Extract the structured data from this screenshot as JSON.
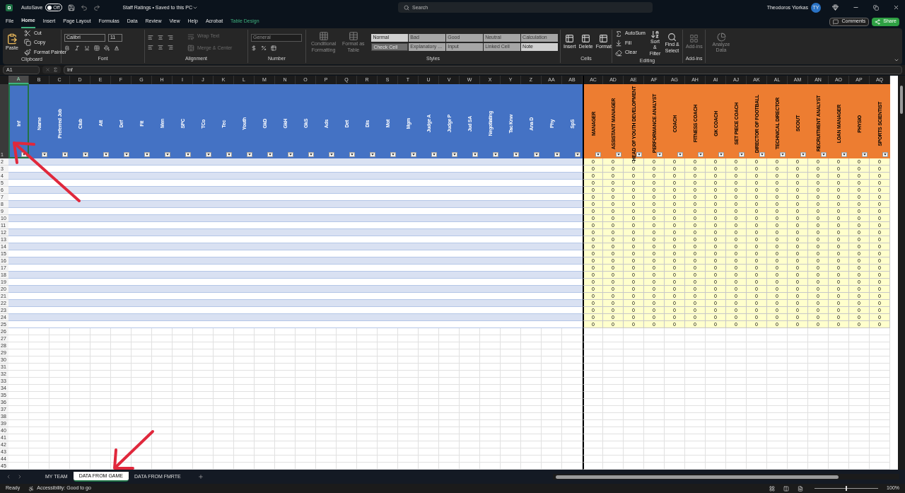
{
  "window": {
    "autosave_label": "AutoSave",
    "autosave_on": false,
    "autosave_state": "Off",
    "title": "Staff Ratings • Saved to this PC",
    "search_placeholder": "Search",
    "user_name": "Theodoros Yiorkas",
    "user_initials": "TY"
  },
  "menu_tabs": [
    {
      "label": "File",
      "selected": false,
      "kind": "standard"
    },
    {
      "label": "Home",
      "selected": true,
      "kind": "standard"
    },
    {
      "label": "Insert",
      "selected": false,
      "kind": "standard"
    },
    {
      "label": "Page Layout",
      "selected": false,
      "kind": "standard"
    },
    {
      "label": "Formulas",
      "selected": false,
      "kind": "standard"
    },
    {
      "label": "Data",
      "selected": false,
      "kind": "standard"
    },
    {
      "label": "Review",
      "selected": false,
      "kind": "standard"
    },
    {
      "label": "View",
      "selected": false,
      "kind": "standard"
    },
    {
      "label": "Help",
      "selected": false,
      "kind": "standard"
    },
    {
      "label": "Acrobat",
      "selected": false,
      "kind": "standard"
    },
    {
      "label": "Table Design",
      "selected": false,
      "kind": "contextual"
    }
  ],
  "actions": {
    "comments": "Comments",
    "share": "Share"
  },
  "ribbon": {
    "clipboard": {
      "label": "Clipboard",
      "paste": "Paste",
      "cut": "Cut",
      "copy": "Copy",
      "format_painter": "Format Painter"
    },
    "font": {
      "label": "Font",
      "font_name": "Calibri",
      "font_size": "11"
    },
    "alignment": {
      "label": "Alignment",
      "wrap_text": {
        "label": "Wrap Text",
        "disabled": true
      },
      "merge": {
        "label": "Merge & Center",
        "disabled": true
      }
    },
    "number": {
      "label": "Number",
      "format": {
        "label": "General",
        "disabled": true
      }
    },
    "styles": {
      "label": "Styles",
      "conditional": {
        "label": "Conditional Formatting",
        "disabled": true
      },
      "format_table": {
        "label": "Format as Table",
        "disabled": true
      },
      "cell_styles": [
        {
          "label": "Normal",
          "kind": "plain"
        },
        {
          "label": "Bad",
          "kind": "muted"
        },
        {
          "label": "Good",
          "kind": "muted"
        },
        {
          "label": "Neutral",
          "kind": "muted"
        },
        {
          "label": "Calculation",
          "kind": "muted"
        },
        {
          "label": "Check Cell",
          "kind": "check"
        },
        {
          "label": "Explanatory ...",
          "kind": "muted"
        },
        {
          "label": "Input",
          "kind": "muted"
        },
        {
          "label": "Linked Cell",
          "kind": "muted"
        },
        {
          "label": "Note",
          "kind": "plain"
        }
      ]
    },
    "cells": {
      "label": "Cells",
      "buttons": [
        "Insert",
        "Delete",
        "Format"
      ]
    },
    "editing": {
      "label": "Editing",
      "autosum": "AutoSum",
      "fill": "Fill",
      "clear": "Clear",
      "sort": "Sort & Filter",
      "find": "Find & Select"
    },
    "addins": {
      "label": "Add-ins",
      "button": {
        "label": "Add-ins",
        "disabled": true
      },
      "analyze": {
        "label": "Analyze Data",
        "disabled": true
      }
    }
  },
  "formula_bar": {
    "name_box": "A1",
    "formula": "Inf"
  },
  "columns": [
    {
      "letter": "A",
      "header": "Inf",
      "kind": "attribute",
      "selected": true
    },
    {
      "letter": "B",
      "header": "Name",
      "kind": "attribute",
      "selected": false
    },
    {
      "letter": "C",
      "header": "Preferred Job",
      "kind": "attribute",
      "selected": false
    },
    {
      "letter": "D",
      "header": "Club",
      "kind": "attribute",
      "selected": false
    },
    {
      "letter": "E",
      "header": "Att",
      "kind": "attribute",
      "selected": false
    },
    {
      "letter": "F",
      "header": "Def",
      "kind": "attribute",
      "selected": false
    },
    {
      "letter": "G",
      "header": "Fit",
      "kind": "attribute",
      "selected": false
    },
    {
      "letter": "H",
      "header": "Men",
      "kind": "attribute",
      "selected": false
    },
    {
      "letter": "I",
      "header": "SPC",
      "kind": "attribute",
      "selected": false
    },
    {
      "letter": "J",
      "header": "TCo",
      "kind": "attribute",
      "selected": false
    },
    {
      "letter": "K",
      "header": "Tec",
      "kind": "attribute",
      "selected": false
    },
    {
      "letter": "L",
      "header": "Youth",
      "kind": "attribute",
      "selected": false
    },
    {
      "letter": "M",
      "header": "GkD",
      "kind": "attribute",
      "selected": false
    },
    {
      "letter": "N",
      "header": "GkH",
      "kind": "attribute",
      "selected": false
    },
    {
      "letter": "O",
      "header": "GkS",
      "kind": "attribute",
      "selected": false
    },
    {
      "letter": "P",
      "header": "Ads",
      "kind": "attribute",
      "selected": false
    },
    {
      "letter": "Q",
      "header": "Det",
      "kind": "attribute",
      "selected": false
    },
    {
      "letter": "R",
      "header": "Dis",
      "kind": "attribute",
      "selected": false
    },
    {
      "letter": "S",
      "header": "Mot",
      "kind": "attribute",
      "selected": false
    },
    {
      "letter": "T",
      "header": "Mgm",
      "kind": "attribute",
      "selected": false
    },
    {
      "letter": "U",
      "header": "Judge A",
      "kind": "attribute",
      "selected": false
    },
    {
      "letter": "V",
      "header": "Judge P",
      "kind": "attribute",
      "selected": false
    },
    {
      "letter": "W",
      "header": "Jud SA",
      "kind": "attribute",
      "selected": false
    },
    {
      "letter": "X",
      "header": "Negotiating",
      "kind": "attribute",
      "selected": false
    },
    {
      "letter": "Y",
      "header": "Tac Knw",
      "kind": "attribute",
      "selected": false
    },
    {
      "letter": "Z",
      "header": "Ana D",
      "kind": "attribute",
      "selected": false
    },
    {
      "letter": "AA",
      "header": "Phy",
      "kind": "attribute",
      "selected": false
    },
    {
      "letter": "AB",
      "header": "SpS",
      "kind": "attribute",
      "selected": false
    },
    {
      "letter": "AC",
      "header": "MANAGER",
      "kind": "staff",
      "selected": false
    },
    {
      "letter": "AD",
      "header": "ASSISTANT MANAGER",
      "kind": "staff",
      "selected": false
    },
    {
      "letter": "AE",
      "header": "HEAD OF YOUTH DEVELOPMENT",
      "kind": "staff",
      "selected": false
    },
    {
      "letter": "AF",
      "header": "PERFORMANCE ANALYST",
      "kind": "staff",
      "selected": false
    },
    {
      "letter": "AG",
      "header": "COACH",
      "kind": "staff",
      "selected": false
    },
    {
      "letter": "AH",
      "header": "FITNESS COACH",
      "kind": "staff",
      "selected": false
    },
    {
      "letter": "AI",
      "header": "GK COACH",
      "kind": "staff",
      "selected": false
    },
    {
      "letter": "AJ",
      "header": "SET PIECE COACH",
      "kind": "staff",
      "selected": false
    },
    {
      "letter": "AK",
      "header": "DIRECTOR OF FOOTBALL",
      "kind": "staff",
      "selected": false
    },
    {
      "letter": "AL",
      "header": "TECHNICAL DIRECTOR",
      "kind": "staff",
      "selected": false
    },
    {
      "letter": "AM",
      "header": "SCOUT",
      "kind": "staff",
      "selected": false
    },
    {
      "letter": "AN",
      "header": "RECRUITMENT ANALYST",
      "kind": "staff",
      "selected": false
    },
    {
      "letter": "AO",
      "header": "LOAN MANAGER",
      "kind": "staff",
      "selected": false
    },
    {
      "letter": "AP",
      "header": "PHYSIO",
      "kind": "staff",
      "selected": false
    },
    {
      "letter": "AQ",
      "header": "SPORTS SCIENTIST",
      "kind": "staff",
      "selected": false
    }
  ],
  "row_numbers": [
    "1",
    "2",
    "3",
    "4",
    "5",
    "6",
    "7",
    "8",
    "9",
    "10",
    "11",
    "12",
    "13",
    "14",
    "15",
    "16",
    "17",
    "18",
    "19",
    "20",
    "21",
    "22",
    "23",
    "24",
    "25",
    "26",
    "27",
    "28",
    "29",
    "30",
    "31",
    "32",
    "33",
    "34",
    "35",
    "36",
    "37",
    "38",
    "39",
    "40",
    "41",
    "42",
    "43",
    "44",
    "45"
  ],
  "staff_values": [
    [
      "0",
      "0",
      "0",
      "0",
      "0",
      "0",
      "0",
      "0",
      "0",
      "0",
      "0",
      "0",
      "0",
      "0",
      "0"
    ],
    [
      "0",
      "0",
      "0",
      "0",
      "0",
      "0",
      "0",
      "0",
      "0",
      "0",
      "0",
      "0",
      "0",
      "0",
      "0"
    ],
    [
      "0",
      "0",
      "0",
      "0",
      "0",
      "0",
      "0",
      "0",
      "0",
      "0",
      "0",
      "0",
      "0",
      "0",
      "0"
    ],
    [
      "0",
      "0",
      "0",
      "0",
      "0",
      "0",
      "0",
      "0",
      "0",
      "0",
      "0",
      "0",
      "0",
      "0",
      "0"
    ],
    [
      "0",
      "0",
      "0",
      "0",
      "0",
      "0",
      "0",
      "0",
      "0",
      "0",
      "0",
      "0",
      "0",
      "0",
      "0"
    ],
    [
      "0",
      "0",
      "0",
      "0",
      "0",
      "0",
      "0",
      "0",
      "0",
      "0",
      "0",
      "0",
      "0",
      "0",
      "0"
    ],
    [
      "0",
      "0",
      "0",
      "0",
      "0",
      "0",
      "0",
      "0",
      "0",
      "0",
      "0",
      "0",
      "0",
      "0",
      "0"
    ],
    [
      "0",
      "0",
      "0",
      "0",
      "0",
      "0",
      "0",
      "0",
      "0",
      "0",
      "0",
      "0",
      "0",
      "0",
      "0"
    ],
    [
      "0",
      "0",
      "0",
      "0",
      "0",
      "0",
      "0",
      "0",
      "0",
      "0",
      "0",
      "0",
      "0",
      "0",
      "0"
    ],
    [
      "0",
      "0",
      "0",
      "0",
      "0",
      "0",
      "0",
      "0",
      "0",
      "0",
      "0",
      "0",
      "0",
      "0",
      "0"
    ],
    [
      "0",
      "0",
      "0",
      "0",
      "0",
      "0",
      "0",
      "0",
      "0",
      "0",
      "0",
      "0",
      "0",
      "0",
      "0"
    ],
    [
      "0",
      "0",
      "0",
      "0",
      "0",
      "0",
      "0",
      "0",
      "0",
      "0",
      "0",
      "0",
      "0",
      "0",
      "0"
    ],
    [
      "0",
      "0",
      "0",
      "0",
      "0",
      "0",
      "0",
      "0",
      "0",
      "0",
      "0",
      "0",
      "0",
      "0",
      "0"
    ],
    [
      "0",
      "0",
      "0",
      "0",
      "0",
      "0",
      "0",
      "0",
      "0",
      "0",
      "0",
      "0",
      "0",
      "0",
      "0"
    ],
    [
      "0",
      "0",
      "0",
      "0",
      "0",
      "0",
      "0",
      "0",
      "0",
      "0",
      "0",
      "0",
      "0",
      "0",
      "0"
    ],
    [
      "0",
      "0",
      "0",
      "0",
      "0",
      "0",
      "0",
      "0",
      "0",
      "0",
      "0",
      "0",
      "0",
      "0",
      "0"
    ],
    [
      "0",
      "0",
      "0",
      "0",
      "0",
      "0",
      "0",
      "0",
      "0",
      "0",
      "0",
      "0",
      "0",
      "0",
      "0"
    ],
    [
      "0",
      "0",
      "0",
      "0",
      "0",
      "0",
      "0",
      "0",
      "0",
      "0",
      "0",
      "0",
      "0",
      "0",
      "0"
    ],
    [
      "0",
      "0",
      "0",
      "0",
      "0",
      "0",
      "0",
      "0",
      "0",
      "0",
      "0",
      "0",
      "0",
      "0",
      "0"
    ],
    [
      "0",
      "0",
      "0",
      "0",
      "0",
      "0",
      "0",
      "0",
      "0",
      "0",
      "0",
      "0",
      "0",
      "0",
      "0"
    ],
    [
      "0",
      "0",
      "0",
      "0",
      "0",
      "0",
      "0",
      "0",
      "0",
      "0",
      "0",
      "0",
      "0",
      "0",
      "0"
    ],
    [
      "0",
      "0",
      "0",
      "0",
      "0",
      "0",
      "0",
      "0",
      "0",
      "0",
      "0",
      "0",
      "0",
      "0",
      "0"
    ],
    [
      "0",
      "0",
      "0",
      "0",
      "0",
      "0",
      "0",
      "0",
      "0",
      "0",
      "0",
      "0",
      "0",
      "0",
      "0"
    ],
    [
      "0",
      "0",
      "0",
      "0",
      "0",
      "0",
      "0",
      "0",
      "0",
      "0",
      "0",
      "0",
      "0",
      "0",
      "0"
    ]
  ],
  "sheet_tabs": [
    {
      "label": "MY TEAM",
      "selected": false
    },
    {
      "label": "DATA FROM GAME",
      "selected": true
    },
    {
      "label": "DATA FROM FMRTE",
      "selected": false
    }
  ],
  "status_bar": {
    "mode": "Ready",
    "accessibility": "Accessibility: Good to go",
    "zoom": "100%",
    "zoom_slider": {
      "level": 0.5
    }
  }
}
